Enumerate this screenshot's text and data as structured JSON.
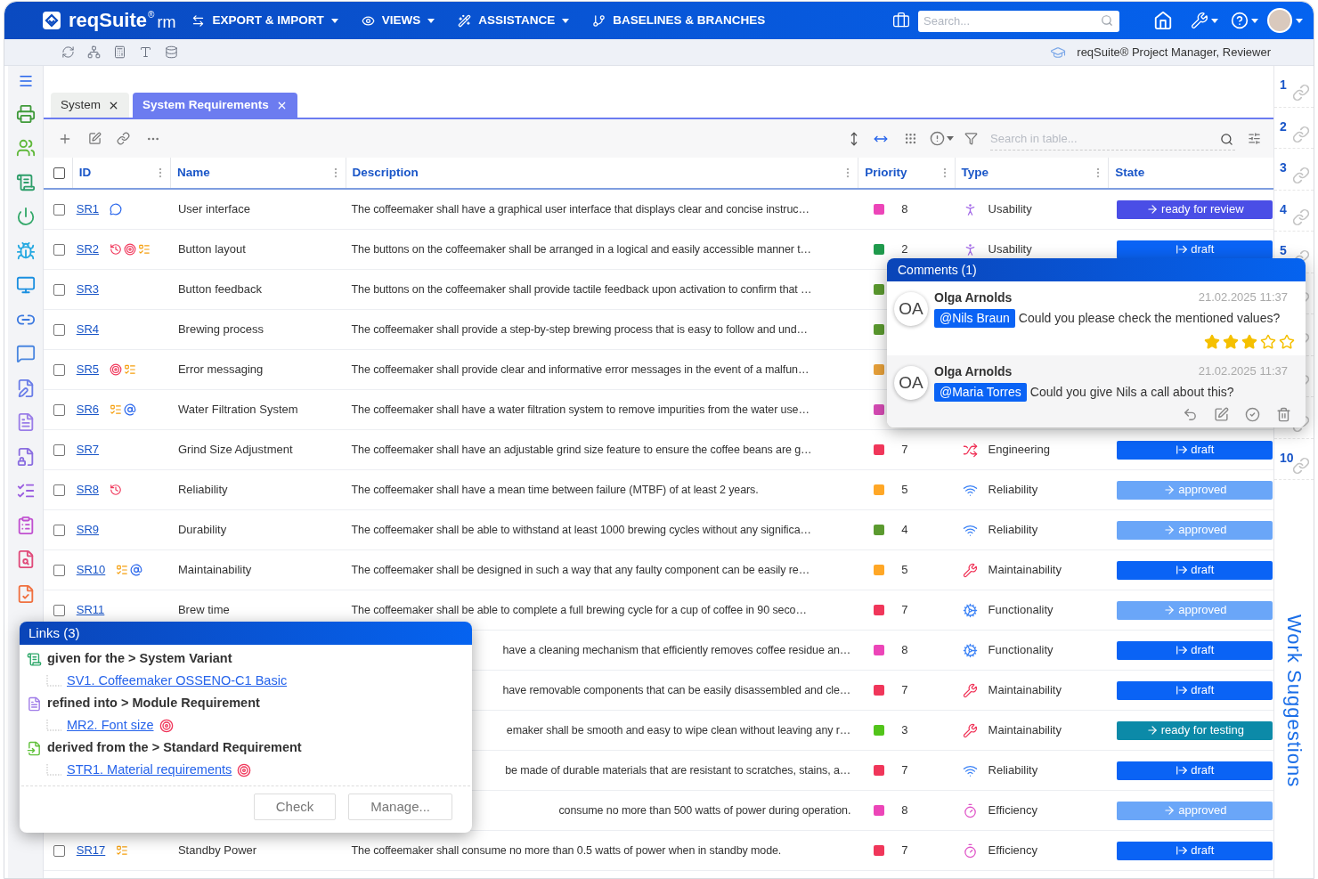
{
  "topbar": {
    "brand": "reqSuite",
    "brand_mark": "®",
    "brand_suffix": "rm",
    "menus": [
      {
        "label": "EXPORT & IMPORT",
        "kind": "export"
      },
      {
        "label": "VIEWS",
        "kind": "views"
      },
      {
        "label": "ASSISTANCE",
        "kind": "assistance"
      },
      {
        "label": "BASELINES & BRANCHES",
        "kind": "branches"
      }
    ],
    "search": {
      "placeholder": "Search..."
    }
  },
  "subbar": {
    "role": "reqSuite® Project Manager, Reviewer"
  },
  "tabs": [
    {
      "label": "System",
      "selected": false
    },
    {
      "label": "System Requirements",
      "selected": true
    }
  ],
  "toolbar": {
    "search": {
      "placeholder": "Search in table..."
    }
  },
  "table": {
    "columns": [
      "ID",
      "Name",
      "Description",
      "Priority",
      "Type",
      "State"
    ],
    "select_all_checked": false,
    "rows": [
      {
        "id": "SR1",
        "checked": false,
        "name": "User interface",
        "description": "The coffeemaker shall have a graphical user interface that displays clear and concise instruc…",
        "has_comment": true,
        "has_history": false,
        "has_issue": false,
        "has_tasks": false,
        "has_mention": false,
        "color": "#ec45b8",
        "priority": "8",
        "type": {
          "label": "Usability",
          "kind": "usability"
        },
        "state": {
          "label": "ready for review",
          "kind": "review"
        }
      },
      {
        "id": "SR2",
        "checked": false,
        "name": "Button layout",
        "description": "The buttons on the coffeemaker shall be arranged in a logical and easily accessible manner t…",
        "has_comment": false,
        "has_history": true,
        "has_issue": true,
        "has_tasks": true,
        "has_mention": false,
        "color": "#1f9a4c",
        "priority": "2",
        "type": {
          "label": "Usability",
          "kind": "usability"
        },
        "state": {
          "label": "draft",
          "kind": "draft"
        }
      },
      {
        "id": "SR3",
        "checked": false,
        "name": "Button feedback",
        "description": "The buttons on the coffeemaker shall provide tactile feedback upon activation to confirm that …",
        "has_comment": false,
        "has_history": false,
        "has_issue": false,
        "has_tasks": false,
        "has_mention": false,
        "color": "#5b9a2f"
      },
      {
        "id": "SR4",
        "checked": false,
        "name": "Brewing process",
        "description": "The coffeemaker shall provide a step-by-step brewing process that is easy to follow and und…",
        "has_comment": false,
        "has_history": false,
        "has_issue": false,
        "has_tasks": false,
        "has_mention": false,
        "color": "#5b9a2f"
      },
      {
        "id": "SR5",
        "checked": false,
        "name": "Error messaging",
        "description": "The coffeemaker shall provide clear and informative error messages in the event of a malfun…",
        "has_comment": false,
        "has_history": false,
        "has_issue": true,
        "has_tasks": true,
        "has_mention": false,
        "color": "#e8a13a"
      },
      {
        "id": "SR6",
        "checked": false,
        "name": "Water Filtration System",
        "description": "The coffeemaker shall have a water filtration system to remove impurities from the water use…",
        "has_comment": false,
        "has_history": false,
        "has_issue": false,
        "has_tasks": true,
        "has_mention": true,
        "color": "#d74bb5"
      },
      {
        "id": "SR7",
        "checked": false,
        "name": "Grind Size Adjustment",
        "description": "The coffeemaker shall have an adjustable grind size feature to ensure the coffee beans are g…",
        "has_comment": false,
        "has_history": false,
        "has_issue": false,
        "has_tasks": false,
        "has_mention": false,
        "color": "#f0365a",
        "priority": "7",
        "type": {
          "label": "Engineering",
          "kind": "engineering"
        },
        "state": {
          "label": "draft",
          "kind": "draft"
        }
      },
      {
        "id": "SR8",
        "checked": false,
        "name": "Reliability",
        "description": "The coffeemaker shall have a mean time between failure (MTBF) of at least 2 years.",
        "has_comment": false,
        "has_history": true,
        "has_issue": false,
        "has_tasks": false,
        "has_mention": false,
        "color": "#ffa726",
        "priority": "5",
        "type": {
          "label": "Reliability",
          "kind": "reliability"
        },
        "state": {
          "label": "approved",
          "kind": "approved"
        }
      },
      {
        "id": "SR9",
        "checked": false,
        "name": "Durability",
        "description": "The coffeemaker shall be able to withstand at least 1000 brewing cycles without any significa…",
        "has_comment": false,
        "has_history": false,
        "has_issue": false,
        "has_tasks": false,
        "has_mention": false,
        "color": "#5b9a2f",
        "priority": "4",
        "type": {
          "label": "Reliability",
          "kind": "reliability"
        },
        "state": {
          "label": "approved",
          "kind": "approved"
        }
      },
      {
        "id": "SR10",
        "checked": false,
        "name": "Maintainability",
        "description": "The coffeemaker shall be designed in such a way that any faulty component can be easily re…",
        "has_comment": false,
        "has_history": false,
        "has_issue": false,
        "has_tasks": true,
        "has_mention": true,
        "color": "#ffa726",
        "priority": "5",
        "type": {
          "label": "Maintainability",
          "kind": "maintainability"
        },
        "state": {
          "label": "draft",
          "kind": "draft"
        }
      },
      {
        "id": "SR11",
        "checked": false,
        "name": "Brew time",
        "description": "The coffeemaker shall be able to complete a full brewing cycle for a cup of coffee in 90 seco…",
        "has_comment": false,
        "has_history": false,
        "has_issue": false,
        "has_tasks": false,
        "has_mention": false,
        "color": "#f0365a",
        "priority": "7",
        "type": {
          "label": "Functionality",
          "kind": "functionality"
        },
        "state": {
          "label": "approved",
          "kind": "approved"
        }
      },
      {
        "description": "have a cleaning mechanism that efficiently removes coffee residue an…",
        "color": "#ec45b8",
        "priority": "8",
        "type": {
          "label": "Functionality",
          "kind": "functionality"
        },
        "state": {
          "label": "draft",
          "kind": "draft"
        }
      },
      {
        "description": "have removable components that can be easily disassembled and cle…",
        "color": "#f0365a",
        "priority": "7",
        "type": {
          "label": "Maintainability",
          "kind": "maintainability"
        },
        "state": {
          "label": "draft",
          "kind": "draft"
        }
      },
      {
        "description": "emaker shall be smooth and easy to wipe clean without leaving any r…",
        "color": "#52c41a",
        "priority": "3",
        "type": {
          "label": "Maintainability",
          "kind": "maintainability"
        },
        "state": {
          "label": "ready for testing",
          "kind": "testing"
        }
      },
      {
        "description": "be made of durable materials that are resistant to scratches, stains, a…",
        "color": "#f0365a",
        "priority": "7",
        "type": {
          "label": "Reliability",
          "kind": "reliability"
        },
        "state": {
          "label": "draft",
          "kind": "draft"
        }
      },
      {
        "description": "consume no more than 500 watts of power during operation.",
        "color": "#ec45b8",
        "priority": "8",
        "type": {
          "label": "Efficiency",
          "kind": "efficiency"
        },
        "state": {
          "label": "approved",
          "kind": "approved"
        }
      },
      {
        "id": "SR17",
        "checked": false,
        "name": "Standby Power",
        "description": "The coffeemaker shall consume no more than 0.5 watts of power when in standby mode.",
        "has_comment": false,
        "has_history": false,
        "has_issue": false,
        "has_tasks": true,
        "has_mention": false,
        "color": "#f0365a",
        "priority": "7",
        "type": {
          "label": "Efficiency",
          "kind": "efficiency"
        },
        "state": {
          "label": "draft",
          "kind": "draft"
        }
      }
    ]
  },
  "link_rail": {
    "items": [
      {
        "kind": "numbered",
        "number": "1"
      },
      {
        "kind": "numbered",
        "number": "2"
      },
      {
        "kind": "numbered",
        "number": "3"
      },
      {
        "kind": "numbered",
        "number": "4"
      },
      {
        "kind": "numbered",
        "number": "5"
      },
      {
        "kind": "icon"
      },
      {
        "kind": "icon"
      },
      {
        "kind": "icon"
      },
      {
        "kind": "icon"
      },
      {
        "kind": "numbered",
        "number": "10"
      }
    ],
    "title": "Work Suggestions"
  },
  "comments": {
    "title": "Comments (1)",
    "items": [
      {
        "initials": "OA",
        "author": "Olga Arnolds",
        "date": "21.02.2025 11:37",
        "mention": "@Nils Braun",
        "text": "Could you please check the mentioned values?",
        "stars": 3,
        "actions": false
      },
      {
        "initials": "OA",
        "author": "Olga Arnolds",
        "date": "21.02.2025 11:37",
        "mention": "@Maria Torres",
        "text": "Could you give Nils a call about this?",
        "actions": true
      }
    ]
  },
  "links": {
    "title": "Links (3)",
    "groups": [
      {
        "kind": "variant",
        "label": "given for the > System Variant",
        "children": [
          {
            "label": "SV1. Coffeemaker OSSENO-C1 Basic",
            "has_issue": false
          }
        ]
      },
      {
        "kind": "module",
        "label": "refined into > Module Requirement",
        "children": [
          {
            "label": "MR2. Font size",
            "has_issue": true
          }
        ]
      },
      {
        "kind": "standard",
        "label": "derived from the > Standard Requirement",
        "children": [
          {
            "label": "STR1. Material requirements",
            "has_issue": true
          }
        ]
      }
    ],
    "buttons": [
      "Check",
      "Manage..."
    ]
  }
}
